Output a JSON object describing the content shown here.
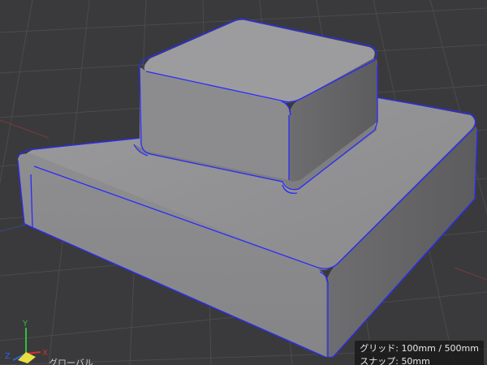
{
  "viewport": {
    "grid_label": "グリッド",
    "grid_value": "100mm / 500mm",
    "snap_label": "スナップ",
    "snap_value": "50mm",
    "coordinate_space": "グローバル",
    "axes": {
      "x": "X",
      "y": "Y",
      "z": "Z"
    }
  },
  "colors": {
    "background": "#3a3a3c",
    "grid_line": "#4a4a4c",
    "grid_major": "#555558",
    "edge_highlight": "#2a2aff",
    "surface": "#8c8c8e",
    "axis_x": "#d03030",
    "axis_y": "#30c040",
    "axis_z": "#3060e0"
  }
}
